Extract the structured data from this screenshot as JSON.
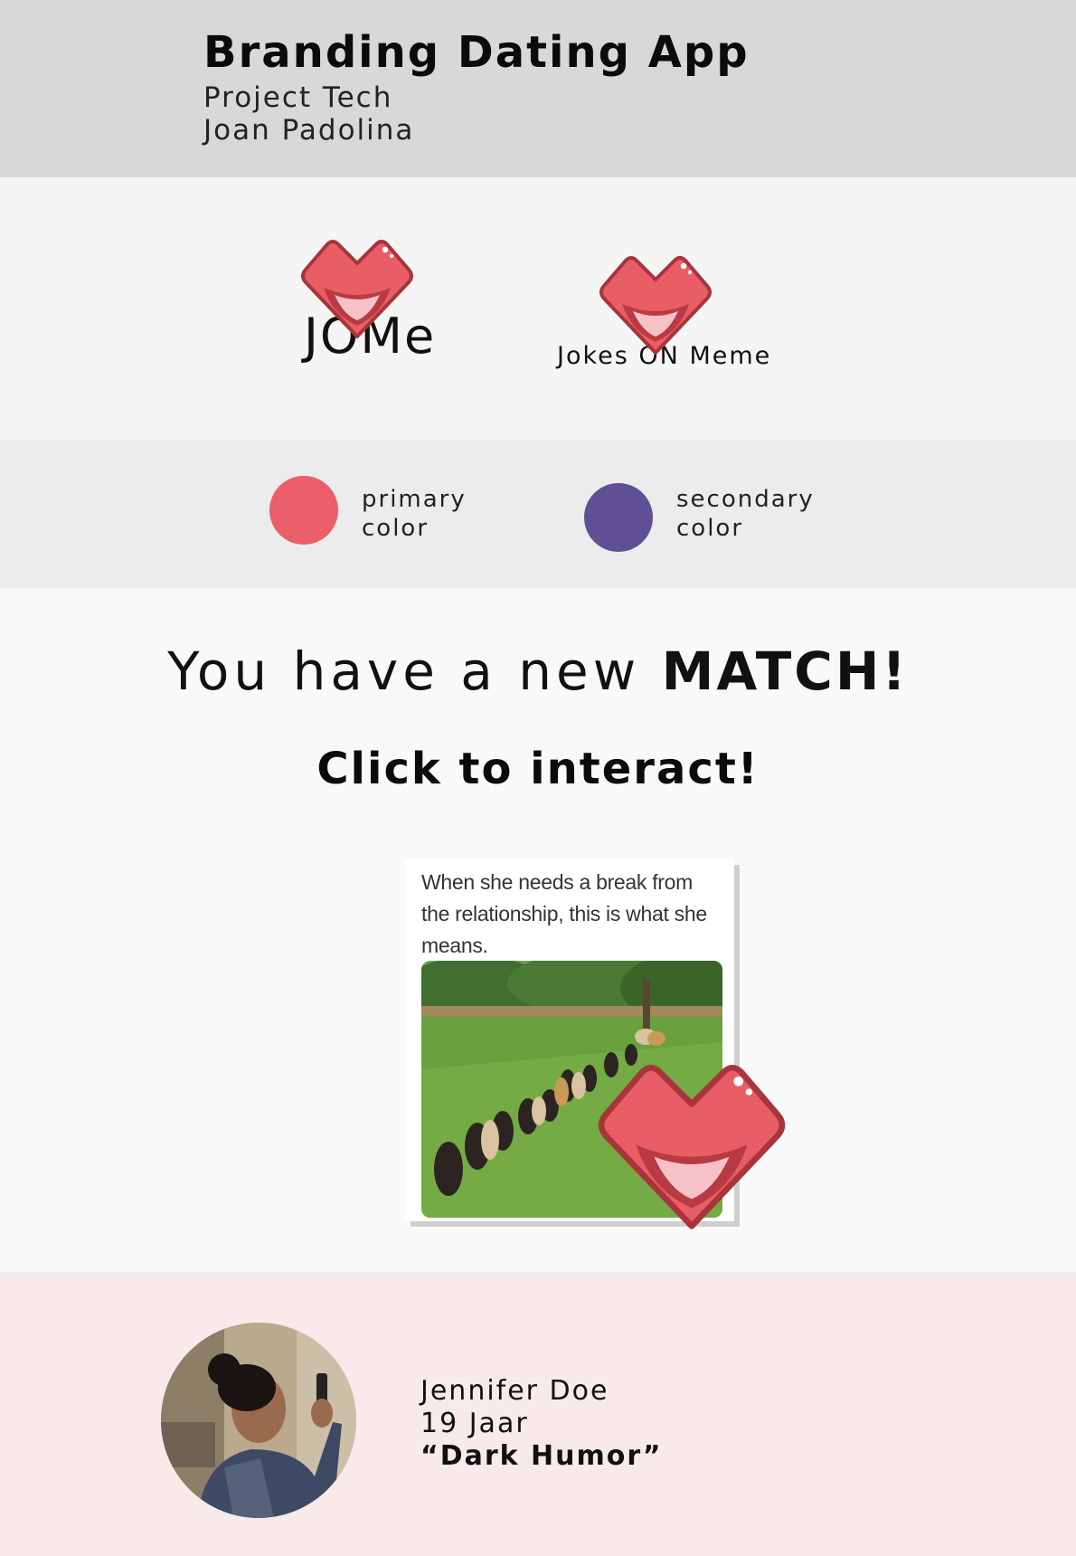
{
  "header": {
    "title": "Branding Dating App",
    "subtitle_1": "Project Tech",
    "subtitle_2": "Joan Padolina"
  },
  "logos": {
    "logo_1_text": "JOMe",
    "logo_2_text": "Jokes ON Meme",
    "icon": "heart-lips-icon"
  },
  "colors": {
    "primary": {
      "label_1": "primary",
      "label_2": "color",
      "hex": "#ea5f6a"
    },
    "secondary": {
      "label_1": "secondary",
      "label_2": "color",
      "hex": "#5f5096"
    }
  },
  "match": {
    "heading_prefix": "You have a new ",
    "heading_emphasis": "MATCH!",
    "cta": "Click to interact!",
    "meme_caption": "When she needs a break from the relationship, this is what she means."
  },
  "profile": {
    "name": "Jennifer Doe",
    "age": "19 Jaar",
    "humor": "“Dark Humor”"
  }
}
